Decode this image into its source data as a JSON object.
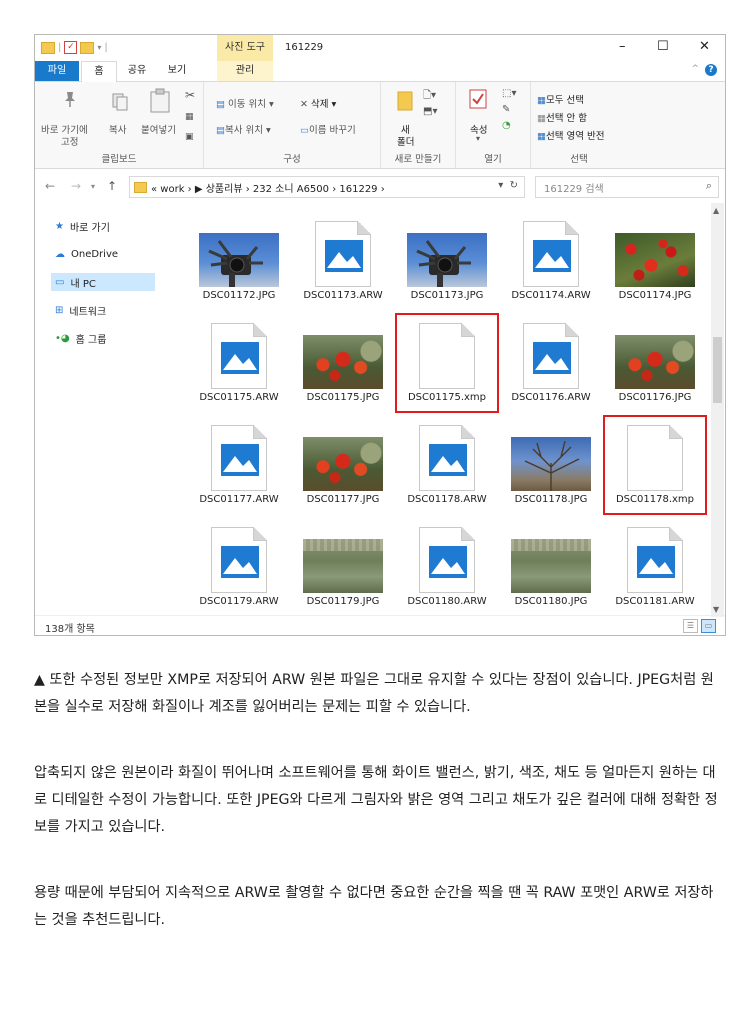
{
  "window": {
    "contextual_tab": "사진 도구",
    "title": "161229",
    "ribbon_tabs": [
      "파일",
      "홈",
      "공유",
      "보기",
      "관리"
    ],
    "help_label": "?"
  },
  "ribbon": {
    "clipboard": {
      "pin_label_1": "바로 가기에",
      "pin_label_2": "고정",
      "copy_label": "복사",
      "paste_label": "붙여넣기",
      "group_label": "클립보드"
    },
    "organize": {
      "move_label": "이동 위치 ▾",
      "copy_to_label": "복사 위치 ▾",
      "delete_label": "삭제 ▾",
      "rename_label": "이름 바꾸기",
      "group_label": "구성"
    },
    "new": {
      "new_folder_label_1": "새",
      "new_folder_label_2": "폴더",
      "group_label": "새로 만들기"
    },
    "open": {
      "properties_label": "속성",
      "group_label": "열기"
    },
    "select": {
      "select_all_label": "모두 선택",
      "select_none_label": "선택 안 함",
      "invert_label": "선택 영역 반전",
      "group_label": "선택"
    }
  },
  "address": {
    "crumbs": "« work › ▶ 상품리뷰 › 232 소니 A6500 › 161229 ›",
    "search_placeholder": "161229 검색"
  },
  "nav_pane": {
    "items": [
      "바로 가기",
      "OneDrive",
      "내 PC",
      "네트워크",
      "홈 그룹"
    ]
  },
  "files": [
    {
      "name": "DSC01172.JPG",
      "kind": "photo",
      "style": "cam"
    },
    {
      "name": "DSC01173.ARW",
      "kind": "doc-image"
    },
    {
      "name": "DSC01173.JPG",
      "kind": "photo",
      "style": "cam"
    },
    {
      "name": "DSC01174.ARW",
      "kind": "doc-image"
    },
    {
      "name": "DSC01174.JPG",
      "kind": "photo",
      "style": "berry"
    },
    {
      "name": "DSC01175.ARW",
      "kind": "doc-image"
    },
    {
      "name": "DSC01175.JPG",
      "kind": "photo",
      "style": "berryb"
    },
    {
      "name": "DSC01175.xmp",
      "kind": "doc-blank",
      "highlighted": true
    },
    {
      "name": "DSC01176.ARW",
      "kind": "doc-image"
    },
    {
      "name": "DSC01176.JPG",
      "kind": "photo",
      "style": "berryb"
    },
    {
      "name": "DSC01177.ARW",
      "kind": "doc-image"
    },
    {
      "name": "DSC01177.JPG",
      "kind": "photo",
      "style": "berryb"
    },
    {
      "name": "DSC01178.ARW",
      "kind": "doc-image"
    },
    {
      "name": "DSC01178.JPG",
      "kind": "photo",
      "style": "tree"
    },
    {
      "name": "DSC01178.xmp",
      "kind": "doc-blank",
      "highlighted": true
    },
    {
      "name": "DSC01179.ARW",
      "kind": "doc-image"
    },
    {
      "name": "DSC01179.JPG",
      "kind": "photo",
      "style": "grass"
    },
    {
      "name": "DSC01180.ARW",
      "kind": "doc-image"
    },
    {
      "name": "DSC01180.JPG",
      "kind": "photo",
      "style": "grass"
    },
    {
      "name": "DSC01181.ARW",
      "kind": "doc-image"
    }
  ],
  "status": {
    "item_count": "138개 항목"
  },
  "article": {
    "p1": "▲ 또한 수정된 정보만 XMP로 저장되어 ARW 원본 파일은 그대로 유지할 수 있다는 장점이 있습니다. JPEG처럼 원본을 실수로 저장해 화질이나 계조를 잃어버리는 문제는 피할 수 있습니다.",
    "p2": "압축되지 않은 원본이라 화질이 뛰어나며 소프트웨어를 통해 화이트 밸런스, 밝기, 색조, 채도 등 얼마든지 원하는 대로 디테일한 수정이 가능합니다. 또한 JPEG와 다르게 그림자와 밝은 영역 그리고 채도가 깊은 컬러에 대해 정확한 정보를 가지고 있습니다.",
    "p3": "용량 때문에 부담되어 지속적으로 ARW로 촬영할 수 없다면 중요한 순간을 찍을 땐 꼭 RAW 포맷인 ARW로 저장하는 것을 추천드립니다."
  },
  "colors": {
    "file_tab": "#1979ca",
    "highlight": "#e01d1d",
    "image_icon": "#1f7ad1",
    "contextual_tab": "#fbe9a7"
  }
}
